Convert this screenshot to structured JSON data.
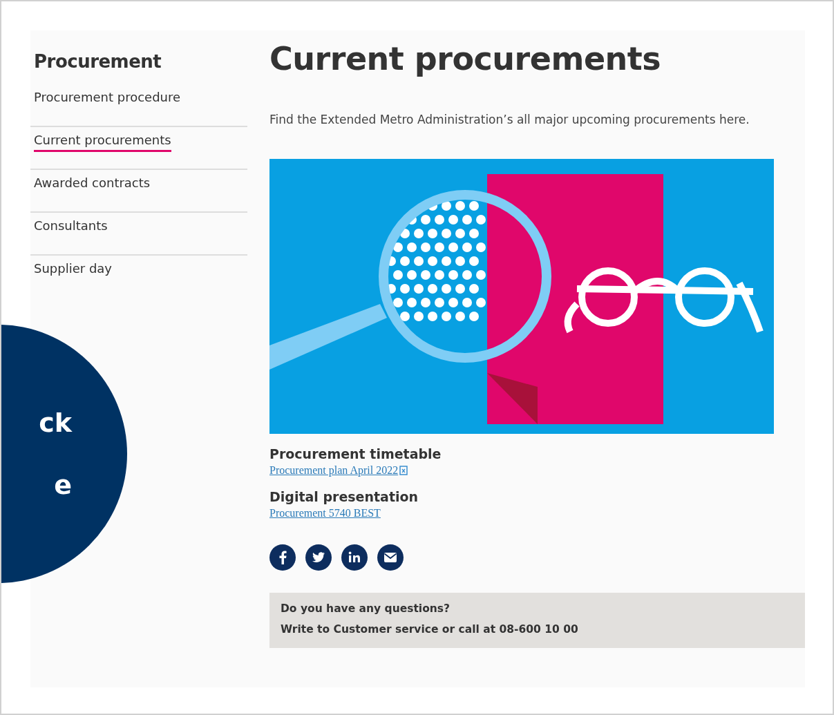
{
  "sidebar": {
    "title": "Procurement",
    "items": [
      {
        "label": "Procurement procedure",
        "selected": false
      },
      {
        "label": "Current procurements",
        "selected": true
      },
      {
        "label": "Awarded contracts",
        "selected": false
      },
      {
        "label": "Consultants",
        "selected": false
      },
      {
        "label": "Supplier day",
        "selected": false
      }
    ]
  },
  "feedback_button": {
    "lines": [
      "ck",
      "e"
    ]
  },
  "main": {
    "title": "Current procurements",
    "intro": "Find the Extended Metro Administration’s all major upcoming procurements here.",
    "sections": [
      {
        "heading": "Procurement timetable",
        "link": "Procurement plan April 2022",
        "file_icon": true
      },
      {
        "heading": "Digital presentation",
        "link": "Procurement 5740 BEST",
        "file_icon": false
      }
    ],
    "share": [
      {
        "kind": "facebook"
      },
      {
        "kind": "twitter"
      },
      {
        "kind": "linkedin"
      },
      {
        "kind": "email"
      }
    ],
    "contact": {
      "question": "Do you have any questions?",
      "text": "Write to Customer service or call at 08-600 10 00"
    }
  }
}
